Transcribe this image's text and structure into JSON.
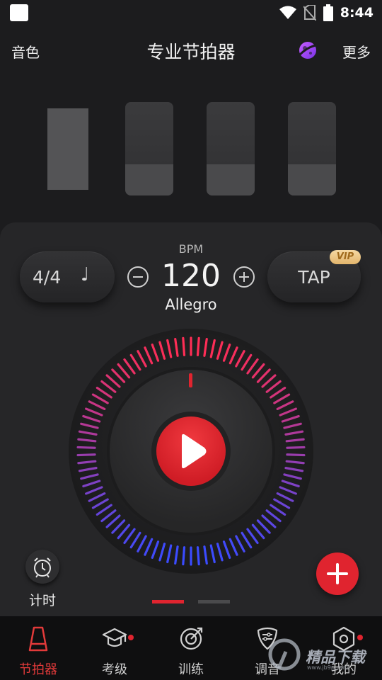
{
  "status_bar": {
    "time": "8:44"
  },
  "header": {
    "left_label": "音色",
    "title": "专业节拍器",
    "right_label": "更多"
  },
  "beats": [
    {
      "state": "active"
    },
    {
      "state": "normal"
    },
    {
      "state": "normal"
    },
    {
      "state": "normal"
    }
  ],
  "controls": {
    "time_signature": "4/4",
    "note_glyph": "♩",
    "bpm_label": "BPM",
    "bpm_value": "120",
    "tempo_marking": "Allegro",
    "tap_label": "TAP",
    "vip_badge": "VIP"
  },
  "timer": {
    "label": "计时"
  },
  "pager": {
    "current_page": 1,
    "total_pages": 2
  },
  "tabs": [
    {
      "label": "节拍器",
      "icon": "metronome-icon",
      "active": true,
      "dot": false
    },
    {
      "label": "考级",
      "icon": "graduation-cap-icon",
      "active": false,
      "dot": true
    },
    {
      "label": "训练",
      "icon": "target-icon",
      "active": false,
      "dot": false
    },
    {
      "label": "调音",
      "icon": "tuner-pick-icon",
      "active": false,
      "dot": false
    },
    {
      "label": "我的",
      "icon": "hex-settings-icon",
      "active": false,
      "dot": true
    }
  ],
  "watermark": {
    "text": "精品下载",
    "url": "www.jb9p.com"
  },
  "colors": {
    "accent": "#e0242f",
    "dial_gradient_start": "#ff2d55",
    "dial_gradient_end": "#3a4bff"
  }
}
